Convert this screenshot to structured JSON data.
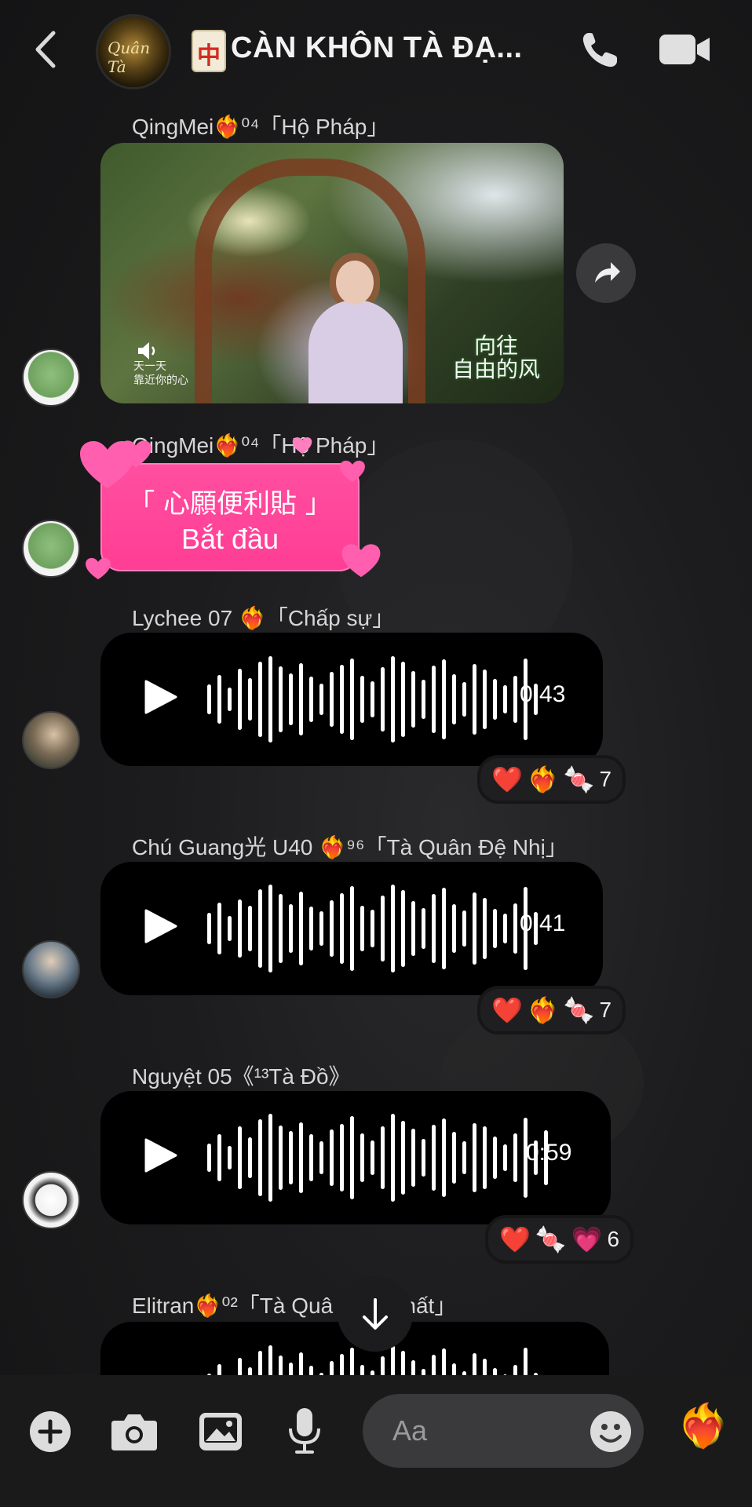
{
  "header": {
    "title": "CÀN KHÔN TÀ ĐẠ...",
    "group_avatar_text": "Quân Tà",
    "mahjong_glyph": "中"
  },
  "messages": [
    {
      "type": "video",
      "sender": "QingMei❤️‍🔥⁰⁴「Hộ Pháp」",
      "subtitle_lines": [
        "天一天",
        "靠近你的心"
      ],
      "overlay_text": [
        "向往",
        "自由的风"
      ]
    },
    {
      "type": "sticker",
      "sender": "QingMei❤️‍🔥⁰⁴「Hộ Pháp」",
      "line1": "「 心願便利貼 」",
      "line2": "Bắt đầu"
    },
    {
      "type": "voice",
      "sender": "Lychee 07 ❤️‍🔥「Chấp sự」",
      "duration": "0:43",
      "reactions": [
        "❤️",
        "❤️‍🔥",
        "🍬"
      ],
      "reaction_count": "7"
    },
    {
      "type": "voice",
      "sender": "Chú Guang光 U40 ❤️‍🔥⁹⁶「Tà Quân Đệ Nhị」",
      "duration": "0:41",
      "reactions": [
        "❤️",
        "❤️‍🔥",
        "🍬"
      ],
      "reaction_count": "7"
    },
    {
      "type": "voice",
      "sender": "Nguyệt 05《¹³Tà Đồ》",
      "duration": "0:59",
      "reactions": [
        "❤️",
        "🍬",
        "💗"
      ],
      "reaction_count": "6"
    },
    {
      "type": "voice",
      "sender": "Elitran❤️‍🔥⁰²「Tà Quâ",
      "sender_tail": "Nhất」",
      "duration": ""
    }
  ],
  "composer": {
    "placeholder": "Aa",
    "quick_reaction": "❤️‍🔥"
  },
  "colors": {
    "background": "#1c1c1e",
    "bubble": "#000000",
    "sticker_pink": "#ff3d95",
    "pill": "#3a3a3c"
  },
  "icons": [
    "back-icon",
    "phone-icon",
    "video-call-icon",
    "share-icon",
    "mute-icon",
    "play-icon",
    "plus-icon",
    "camera-icon",
    "gallery-icon",
    "mic-icon",
    "emoji-icon",
    "arrow-down-icon"
  ]
}
